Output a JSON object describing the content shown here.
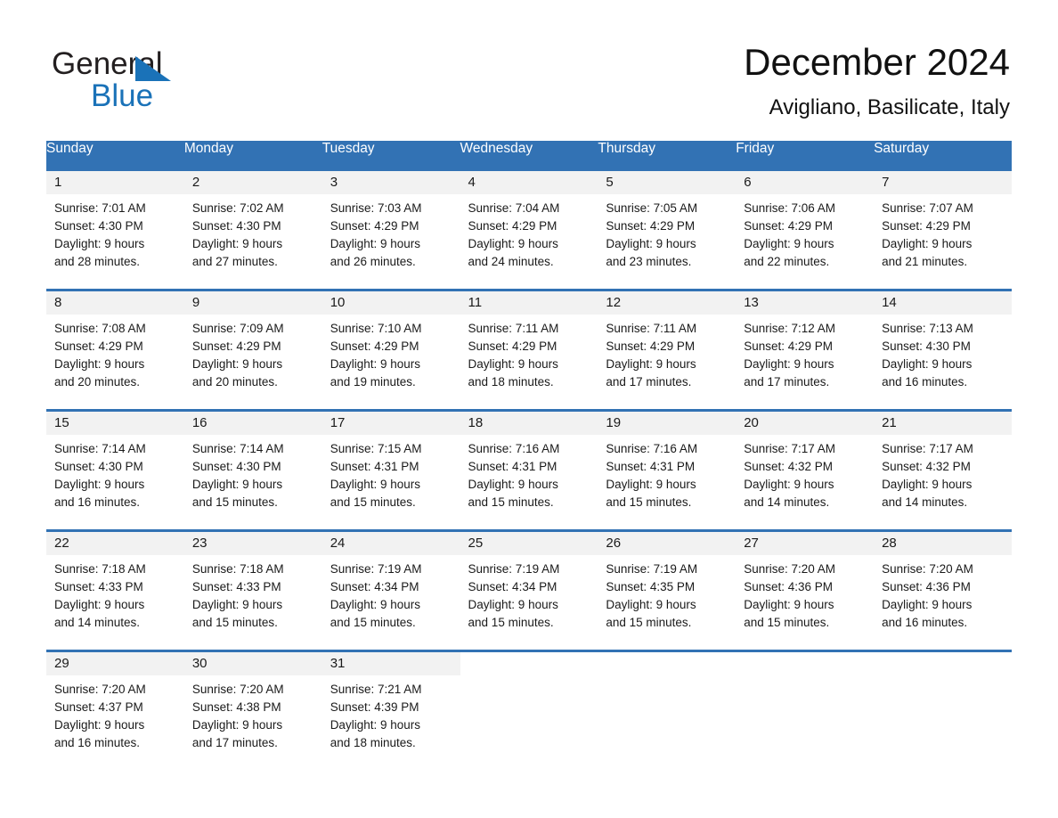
{
  "brand": {
    "name_part1": "General",
    "name_part2": "Blue",
    "triangle_color": "#1a72b8",
    "text_color": "#231f20"
  },
  "header": {
    "title": "December 2024",
    "subtitle": "Avigliano, Basilicate, Italy"
  },
  "colors": {
    "header_blue": "#3272b4",
    "daynum_band": "#f2f2f2",
    "text": "#1a1a1a"
  },
  "weekday_headers": [
    "Sunday",
    "Monday",
    "Tuesday",
    "Wednesday",
    "Thursday",
    "Friday",
    "Saturday"
  ],
  "weeks": [
    [
      {
        "day": "1",
        "sunrise": "Sunrise: 7:01 AM",
        "sunset": "Sunset: 4:30 PM",
        "daylight1": "Daylight: 9 hours",
        "daylight2": "and 28 minutes."
      },
      {
        "day": "2",
        "sunrise": "Sunrise: 7:02 AM",
        "sunset": "Sunset: 4:30 PM",
        "daylight1": "Daylight: 9 hours",
        "daylight2": "and 27 minutes."
      },
      {
        "day": "3",
        "sunrise": "Sunrise: 7:03 AM",
        "sunset": "Sunset: 4:29 PM",
        "daylight1": "Daylight: 9 hours",
        "daylight2": "and 26 minutes."
      },
      {
        "day": "4",
        "sunrise": "Sunrise: 7:04 AM",
        "sunset": "Sunset: 4:29 PM",
        "daylight1": "Daylight: 9 hours",
        "daylight2": "and 24 minutes."
      },
      {
        "day": "5",
        "sunrise": "Sunrise: 7:05 AM",
        "sunset": "Sunset: 4:29 PM",
        "daylight1": "Daylight: 9 hours",
        "daylight2": "and 23 minutes."
      },
      {
        "day": "6",
        "sunrise": "Sunrise: 7:06 AM",
        "sunset": "Sunset: 4:29 PM",
        "daylight1": "Daylight: 9 hours",
        "daylight2": "and 22 minutes."
      },
      {
        "day": "7",
        "sunrise": "Sunrise: 7:07 AM",
        "sunset": "Sunset: 4:29 PM",
        "daylight1": "Daylight: 9 hours",
        "daylight2": "and 21 minutes."
      }
    ],
    [
      {
        "day": "8",
        "sunrise": "Sunrise: 7:08 AM",
        "sunset": "Sunset: 4:29 PM",
        "daylight1": "Daylight: 9 hours",
        "daylight2": "and 20 minutes."
      },
      {
        "day": "9",
        "sunrise": "Sunrise: 7:09 AM",
        "sunset": "Sunset: 4:29 PM",
        "daylight1": "Daylight: 9 hours",
        "daylight2": "and 20 minutes."
      },
      {
        "day": "10",
        "sunrise": "Sunrise: 7:10 AM",
        "sunset": "Sunset: 4:29 PM",
        "daylight1": "Daylight: 9 hours",
        "daylight2": "and 19 minutes."
      },
      {
        "day": "11",
        "sunrise": "Sunrise: 7:11 AM",
        "sunset": "Sunset: 4:29 PM",
        "daylight1": "Daylight: 9 hours",
        "daylight2": "and 18 minutes."
      },
      {
        "day": "12",
        "sunrise": "Sunrise: 7:11 AM",
        "sunset": "Sunset: 4:29 PM",
        "daylight1": "Daylight: 9 hours",
        "daylight2": "and 17 minutes."
      },
      {
        "day": "13",
        "sunrise": "Sunrise: 7:12 AM",
        "sunset": "Sunset: 4:29 PM",
        "daylight1": "Daylight: 9 hours",
        "daylight2": "and 17 minutes."
      },
      {
        "day": "14",
        "sunrise": "Sunrise: 7:13 AM",
        "sunset": "Sunset: 4:30 PM",
        "daylight1": "Daylight: 9 hours",
        "daylight2": "and 16 minutes."
      }
    ],
    [
      {
        "day": "15",
        "sunrise": "Sunrise: 7:14 AM",
        "sunset": "Sunset: 4:30 PM",
        "daylight1": "Daylight: 9 hours",
        "daylight2": "and 16 minutes."
      },
      {
        "day": "16",
        "sunrise": "Sunrise: 7:14 AM",
        "sunset": "Sunset: 4:30 PM",
        "daylight1": "Daylight: 9 hours",
        "daylight2": "and 15 minutes."
      },
      {
        "day": "17",
        "sunrise": "Sunrise: 7:15 AM",
        "sunset": "Sunset: 4:31 PM",
        "daylight1": "Daylight: 9 hours",
        "daylight2": "and 15 minutes."
      },
      {
        "day": "18",
        "sunrise": "Sunrise: 7:16 AM",
        "sunset": "Sunset: 4:31 PM",
        "daylight1": "Daylight: 9 hours",
        "daylight2": "and 15 minutes."
      },
      {
        "day": "19",
        "sunrise": "Sunrise: 7:16 AM",
        "sunset": "Sunset: 4:31 PM",
        "daylight1": "Daylight: 9 hours",
        "daylight2": "and 15 minutes."
      },
      {
        "day": "20",
        "sunrise": "Sunrise: 7:17 AM",
        "sunset": "Sunset: 4:32 PM",
        "daylight1": "Daylight: 9 hours",
        "daylight2": "and 14 minutes."
      },
      {
        "day": "21",
        "sunrise": "Sunrise: 7:17 AM",
        "sunset": "Sunset: 4:32 PM",
        "daylight1": "Daylight: 9 hours",
        "daylight2": "and 14 minutes."
      }
    ],
    [
      {
        "day": "22",
        "sunrise": "Sunrise: 7:18 AM",
        "sunset": "Sunset: 4:33 PM",
        "daylight1": "Daylight: 9 hours",
        "daylight2": "and 14 minutes."
      },
      {
        "day": "23",
        "sunrise": "Sunrise: 7:18 AM",
        "sunset": "Sunset: 4:33 PM",
        "daylight1": "Daylight: 9 hours",
        "daylight2": "and 15 minutes."
      },
      {
        "day": "24",
        "sunrise": "Sunrise: 7:19 AM",
        "sunset": "Sunset: 4:34 PM",
        "daylight1": "Daylight: 9 hours",
        "daylight2": "and 15 minutes."
      },
      {
        "day": "25",
        "sunrise": "Sunrise: 7:19 AM",
        "sunset": "Sunset: 4:34 PM",
        "daylight1": "Daylight: 9 hours",
        "daylight2": "and 15 minutes."
      },
      {
        "day": "26",
        "sunrise": "Sunrise: 7:19 AM",
        "sunset": "Sunset: 4:35 PM",
        "daylight1": "Daylight: 9 hours",
        "daylight2": "and 15 minutes."
      },
      {
        "day": "27",
        "sunrise": "Sunrise: 7:20 AM",
        "sunset": "Sunset: 4:36 PM",
        "daylight1": "Daylight: 9 hours",
        "daylight2": "and 15 minutes."
      },
      {
        "day": "28",
        "sunrise": "Sunrise: 7:20 AM",
        "sunset": "Sunset: 4:36 PM",
        "daylight1": "Daylight: 9 hours",
        "daylight2": "and 16 minutes."
      }
    ],
    [
      {
        "day": "29",
        "sunrise": "Sunrise: 7:20 AM",
        "sunset": "Sunset: 4:37 PM",
        "daylight1": "Daylight: 9 hours",
        "daylight2": "and 16 minutes."
      },
      {
        "day": "30",
        "sunrise": "Sunrise: 7:20 AM",
        "sunset": "Sunset: 4:38 PM",
        "daylight1": "Daylight: 9 hours",
        "daylight2": "and 17 minutes."
      },
      {
        "day": "31",
        "sunrise": "Sunrise: 7:21 AM",
        "sunset": "Sunset: 4:39 PM",
        "daylight1": "Daylight: 9 hours",
        "daylight2": "and 18 minutes."
      },
      {
        "day": "",
        "sunrise": "",
        "sunset": "",
        "daylight1": "",
        "daylight2": ""
      },
      {
        "day": "",
        "sunrise": "",
        "sunset": "",
        "daylight1": "",
        "daylight2": ""
      },
      {
        "day": "",
        "sunrise": "",
        "sunset": "",
        "daylight1": "",
        "daylight2": ""
      },
      {
        "day": "",
        "sunrise": "",
        "sunset": "",
        "daylight1": "",
        "daylight2": ""
      }
    ]
  ]
}
